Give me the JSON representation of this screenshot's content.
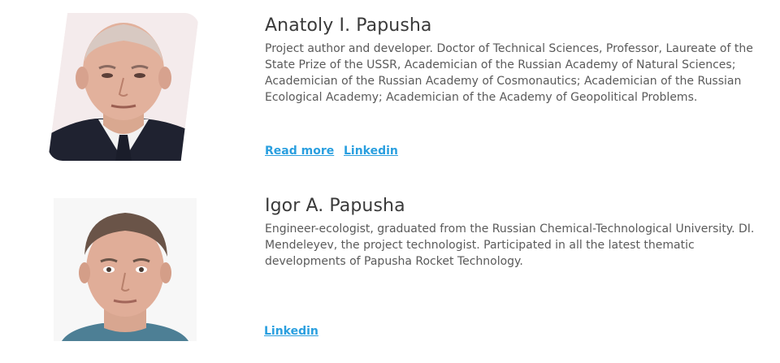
{
  "people": [
    {
      "name": "Anatoly I. Papusha",
      "bio": "Project author and developer. Doctor of Technical Sciences, Professor, Laureate of the State Prize of the USSR, Academician of the Russian Academy of Natural Sciences; Academician of the Russian Academy of Cosmonautics; Academician of the Russian Ecological Academy; Academician of the Academy of Geopolitical Problems.",
      "read_more_label": "Read more",
      "linkedin_label": "Linkedin"
    },
    {
      "name": "Igor A. Papusha",
      "bio": "Engineer-ecologist, graduated from the Russian Chemical-Technological University. DI. Mendeleyev, the project technologist. Participated in all the latest thematic developments of Papusha Rocket Technology.",
      "linkedin_label": "Linkedin"
    }
  ],
  "colors": {
    "link": "#2a9fdf",
    "name_text": "#3a3a3a",
    "bio_text": "#5a5a5a"
  }
}
